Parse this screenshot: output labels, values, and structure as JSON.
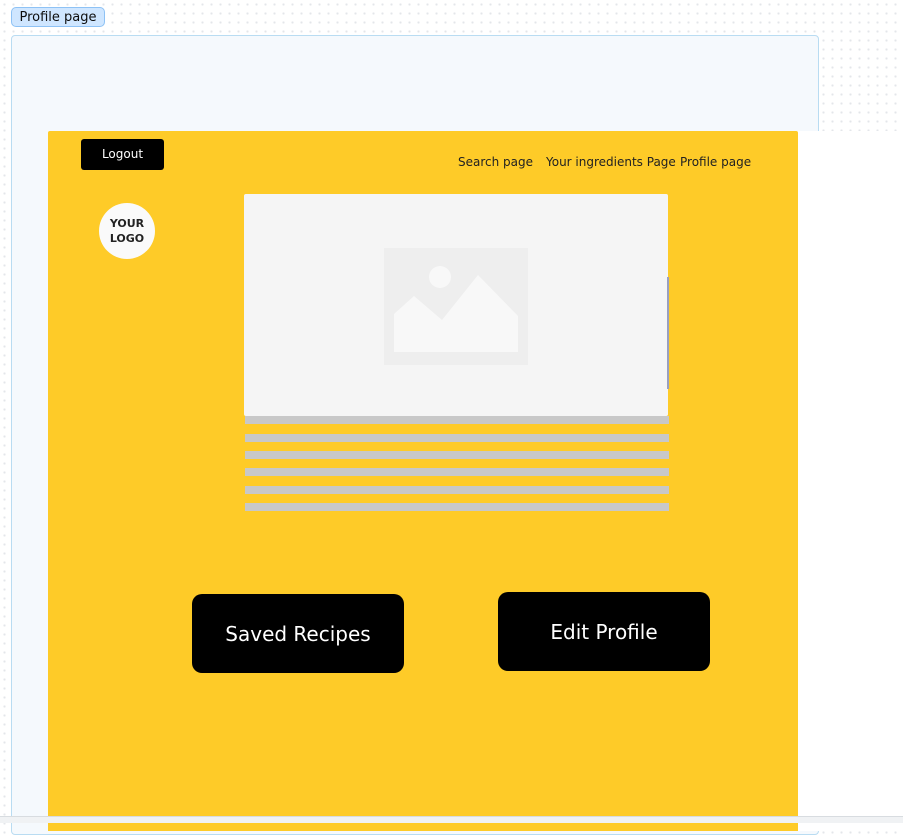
{
  "canvas": {
    "frame_label": "Profile page"
  },
  "header": {
    "logout_label": "Logout",
    "nav": [
      "Search page",
      "Your ingredients Page",
      "Profile page"
    ]
  },
  "logo": {
    "line1": "YOUR",
    "line2": "LOGO"
  },
  "content": {
    "image_icon": "image-placeholder-icon",
    "text_line_count": 6
  },
  "actions": {
    "saved_recipes_label": "Saved Recipes",
    "edit_profile_label": "Edit Profile"
  },
  "colors": {
    "page_background": "#fecb28",
    "button": "#000000",
    "placeholder": "#f5f5f5",
    "text_line": "#c8c8c8"
  }
}
